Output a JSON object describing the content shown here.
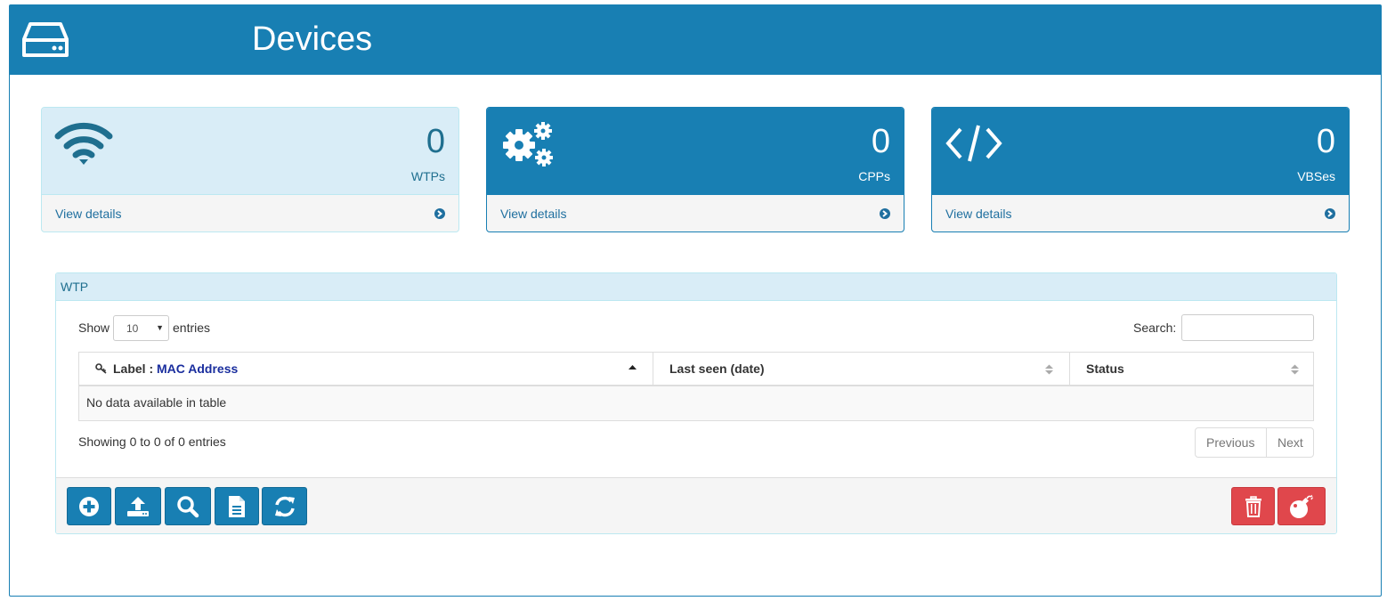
{
  "header": {
    "title": "Devices",
    "logo_icon": "hard-drive-icon"
  },
  "colors": {
    "primary": "#187fb3",
    "info_bg": "#d9edf7",
    "danger": "#e0474c"
  },
  "cards": [
    {
      "icon": "wifi-icon",
      "count": "0",
      "label": "WTPs",
      "link": "View details"
    },
    {
      "icon": "gears-icon",
      "count": "0",
      "label": "CPPs",
      "link": "View details"
    },
    {
      "icon": "code-icon",
      "count": "0",
      "label": "VBSes",
      "link": "View details"
    }
  ],
  "panel": {
    "title": "WTP",
    "length": {
      "show": "Show",
      "value": "10",
      "entries": "entries"
    },
    "search": {
      "label": "Search:",
      "value": ""
    },
    "columns": [
      {
        "label": "Label : ",
        "label_highlight": "MAC Address"
      },
      {
        "label": "Last seen (date)"
      },
      {
        "label": "Status"
      }
    ],
    "empty_message": "No data available in table",
    "info": "Showing 0 to 0 of 0 entries",
    "pagination": {
      "previous": "Previous",
      "next": "Next"
    },
    "toolbar": [
      {
        "icon": "plus-circle-icon"
      },
      {
        "icon": "upload-icon"
      },
      {
        "icon": "search-icon"
      },
      {
        "icon": "document-icon"
      },
      {
        "icon": "refresh-icon"
      },
      {
        "icon": "trash-icon"
      },
      {
        "icon": "bomb-icon"
      }
    ]
  }
}
